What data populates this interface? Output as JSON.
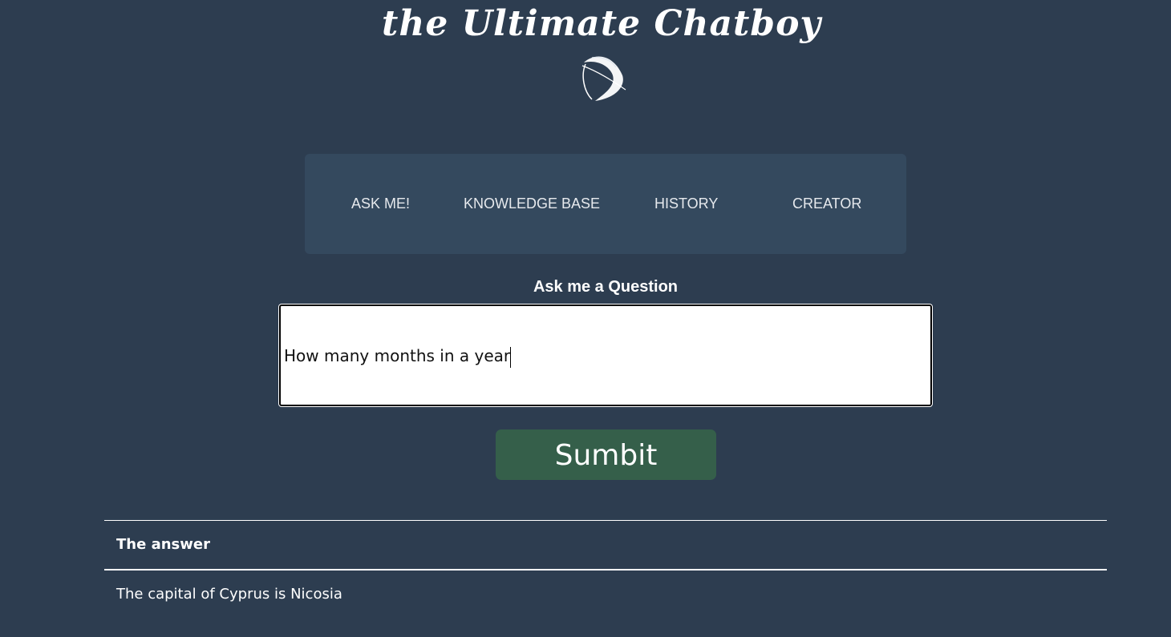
{
  "header": {
    "title": "the Ultimate Chatboy",
    "logo_icon": "orbit-sphere-icon"
  },
  "nav": {
    "items": [
      {
        "label": "ASK ME!"
      },
      {
        "label": "KNOWLEDGE BASE"
      },
      {
        "label": "HISTORY"
      },
      {
        "label": "CREATOR"
      }
    ]
  },
  "form": {
    "label": "Ask me a Question",
    "question_value": "How many months in a year",
    "submit_label": "Sumbit"
  },
  "answer": {
    "heading": "The answer",
    "text": "The capital of Cyprus is Nicosia"
  },
  "colors": {
    "background": "#2d3d50",
    "nav_background": "#34495e",
    "submit_background": "#355f4a"
  }
}
